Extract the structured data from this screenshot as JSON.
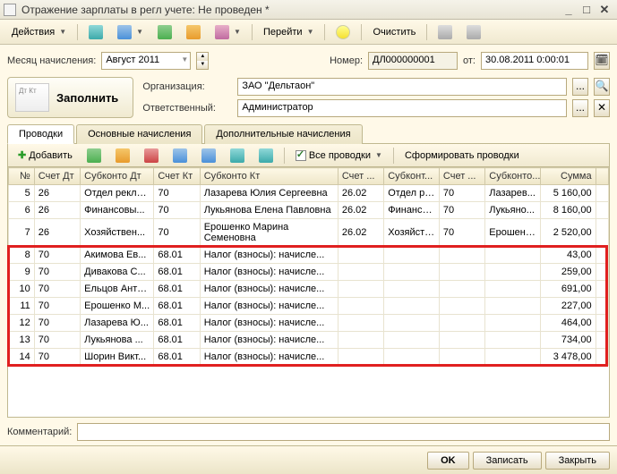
{
  "window": {
    "title": "Отражение зарплаты в регл учете: Не проведен *"
  },
  "toolbar": {
    "actions": "Действия",
    "go": "Перейти",
    "clear": "Очистить"
  },
  "period": {
    "label": "Месяц начисления:",
    "value": "Август 2011"
  },
  "number": {
    "label": "Номер:",
    "value": "ДЛ000000001"
  },
  "date": {
    "label": "от:",
    "value": "30.08.2011 0:00:01"
  },
  "org": {
    "label": "Организация:",
    "value": "ЗАО \"Дельтаон\""
  },
  "resp": {
    "label": "Ответственный:",
    "value": "Администратор"
  },
  "fill_btn": "Заполнить",
  "tabs": {
    "t1": "Проводки",
    "t2": "Основные начисления",
    "t3": "Дополнительные начисления"
  },
  "subtoolbar": {
    "add": "Добавить",
    "allpost": "Все проводки",
    "form": "Сформировать проводки"
  },
  "grid": {
    "headers": {
      "n": "№",
      "dt": "Счет Дт",
      "sdt": "Субконто Дт",
      "kt": "Счет Кт",
      "skt": "Субконто Кт",
      "c1": "Счет ...",
      "c2": "Субконт...",
      "c3": "Счет ...",
      "c4": "Субконто...",
      "sum": "Сумма"
    },
    "rows": [
      {
        "n": "5",
        "dt": "26",
        "sdt": "Отдел рекла...",
        "kt": "70",
        "skt": "Лазарева Юлия Сергеевна",
        "c1": "26.02",
        "c2": "Отдел ре...",
        "c3": "70",
        "c4": "Лазарев...",
        "sum": "5 160,00",
        "hi": false
      },
      {
        "n": "6",
        "dt": "26",
        "sdt": "Финансовы...",
        "kt": "70",
        "skt": "Лукьянова Елена Павловна",
        "c1": "26.02",
        "c2": "Финансо...",
        "c3": "70",
        "c4": "Лукьяно...",
        "sum": "8 160,00",
        "hi": false
      },
      {
        "n": "7",
        "dt": "26",
        "sdt": "Хозяйствен...",
        "kt": "70",
        "skt": "Ерошенко Марина Семеновна",
        "c1": "26.02",
        "c2": "Хозяйств...",
        "c3": "70",
        "c4": "Ерошенк...",
        "sum": "2 520,00",
        "hi": false
      },
      {
        "n": "8",
        "dt": "70",
        "sdt": "Акимова Ев...",
        "kt": "68.01",
        "skt": "Налог (взносы): начисле...",
        "c1": "",
        "c2": "",
        "c3": "",
        "c4": "",
        "sum": "43,00",
        "hi": true
      },
      {
        "n": "9",
        "dt": "70",
        "sdt": "Дивакова С...",
        "kt": "68.01",
        "skt": "Налог (взносы): начисле...",
        "c1": "",
        "c2": "",
        "c3": "",
        "c4": "",
        "sum": "259,00",
        "hi": true
      },
      {
        "n": "10",
        "dt": "70",
        "sdt": "Ельцов Анто...",
        "kt": "68.01",
        "skt": "Налог (взносы): начисле...",
        "c1": "",
        "c2": "",
        "c3": "",
        "c4": "",
        "sum": "691,00",
        "hi": true
      },
      {
        "n": "11",
        "dt": "70",
        "sdt": "Ерошенко М...",
        "kt": "68.01",
        "skt": "Налог (взносы): начисле...",
        "c1": "",
        "c2": "",
        "c3": "",
        "c4": "",
        "sum": "227,00",
        "hi": true
      },
      {
        "n": "12",
        "dt": "70",
        "sdt": "Лазарева Ю...",
        "kt": "68.01",
        "skt": "Налог (взносы): начисле...",
        "c1": "",
        "c2": "",
        "c3": "",
        "c4": "",
        "sum": "464,00",
        "hi": true
      },
      {
        "n": "13",
        "dt": "70",
        "sdt": "Лукьянова ...",
        "kt": "68.01",
        "skt": "Налог (взносы): начисле...",
        "c1": "",
        "c2": "",
        "c3": "",
        "c4": "",
        "sum": "734,00",
        "hi": true
      },
      {
        "n": "14",
        "dt": "70",
        "sdt": "Шорин Викт...",
        "kt": "68.01",
        "skt": "Налог (взносы): начисле...",
        "c1": "",
        "c2": "",
        "c3": "",
        "c4": "",
        "sum": "3 478,00",
        "hi": true
      }
    ]
  },
  "comment": {
    "label": "Комментарий:",
    "value": ""
  },
  "footer": {
    "ok": "OK",
    "save": "Записать",
    "close": "Закрыть"
  }
}
